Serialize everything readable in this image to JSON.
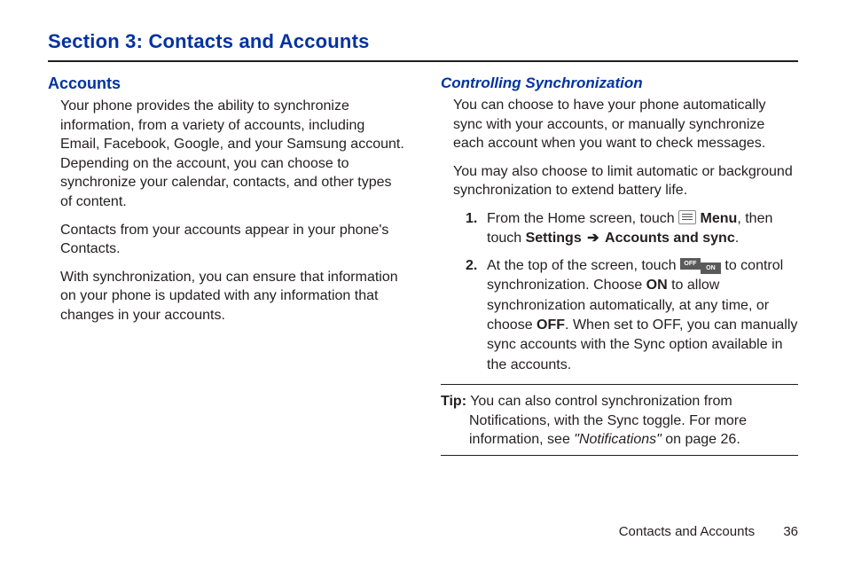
{
  "section_title": "Section 3: Contacts and Accounts",
  "left": {
    "heading": "Accounts",
    "p1": "Your phone provides the ability to synchronize information, from a variety of accounts, including Email, Facebook, Google, and your Samsung account. Depending on the account, you can choose to synchronize your calendar, contacts, and other types of content.",
    "p2": "Contacts from your accounts appear in your phone's Contacts.",
    "p3": "With synchronization, you can ensure that information on your phone is updated with any information that changes in your accounts."
  },
  "right": {
    "heading": "Controlling Synchronization",
    "p1": "You can choose to have your phone automatically sync with your accounts, or manually synchronize each account when you want to check messages.",
    "p2": "You may also choose to limit automatic or background synchronization to extend battery life.",
    "step1": {
      "num": "1.",
      "a": "From the Home screen, touch ",
      "menu": " Menu",
      "b": ", then touch ",
      "settings": "Settings",
      "arrow": " ➔ ",
      "accounts_sync": "Accounts and sync",
      "c": "."
    },
    "step2": {
      "num": "2.",
      "a": "At the top of the screen, touch ",
      "toggle_off": "OFF",
      "toggle_on": "ON",
      "b": " to control synchronization. Choose ",
      "on": "ON",
      "c": " to allow synchronization automatically, at any time, or choose ",
      "off": "OFF",
      "d": ". When set to OFF, you can manually sync accounts with the Sync option available in the accounts."
    },
    "tip": {
      "label": "Tip:",
      "a": " You can also control synchronization from Notifications, with the Sync toggle. For more information, see ",
      "ref": "\"Notifications\"",
      "b": " on page 26."
    }
  },
  "footer": {
    "text": "Contacts and Accounts",
    "page": "36"
  }
}
